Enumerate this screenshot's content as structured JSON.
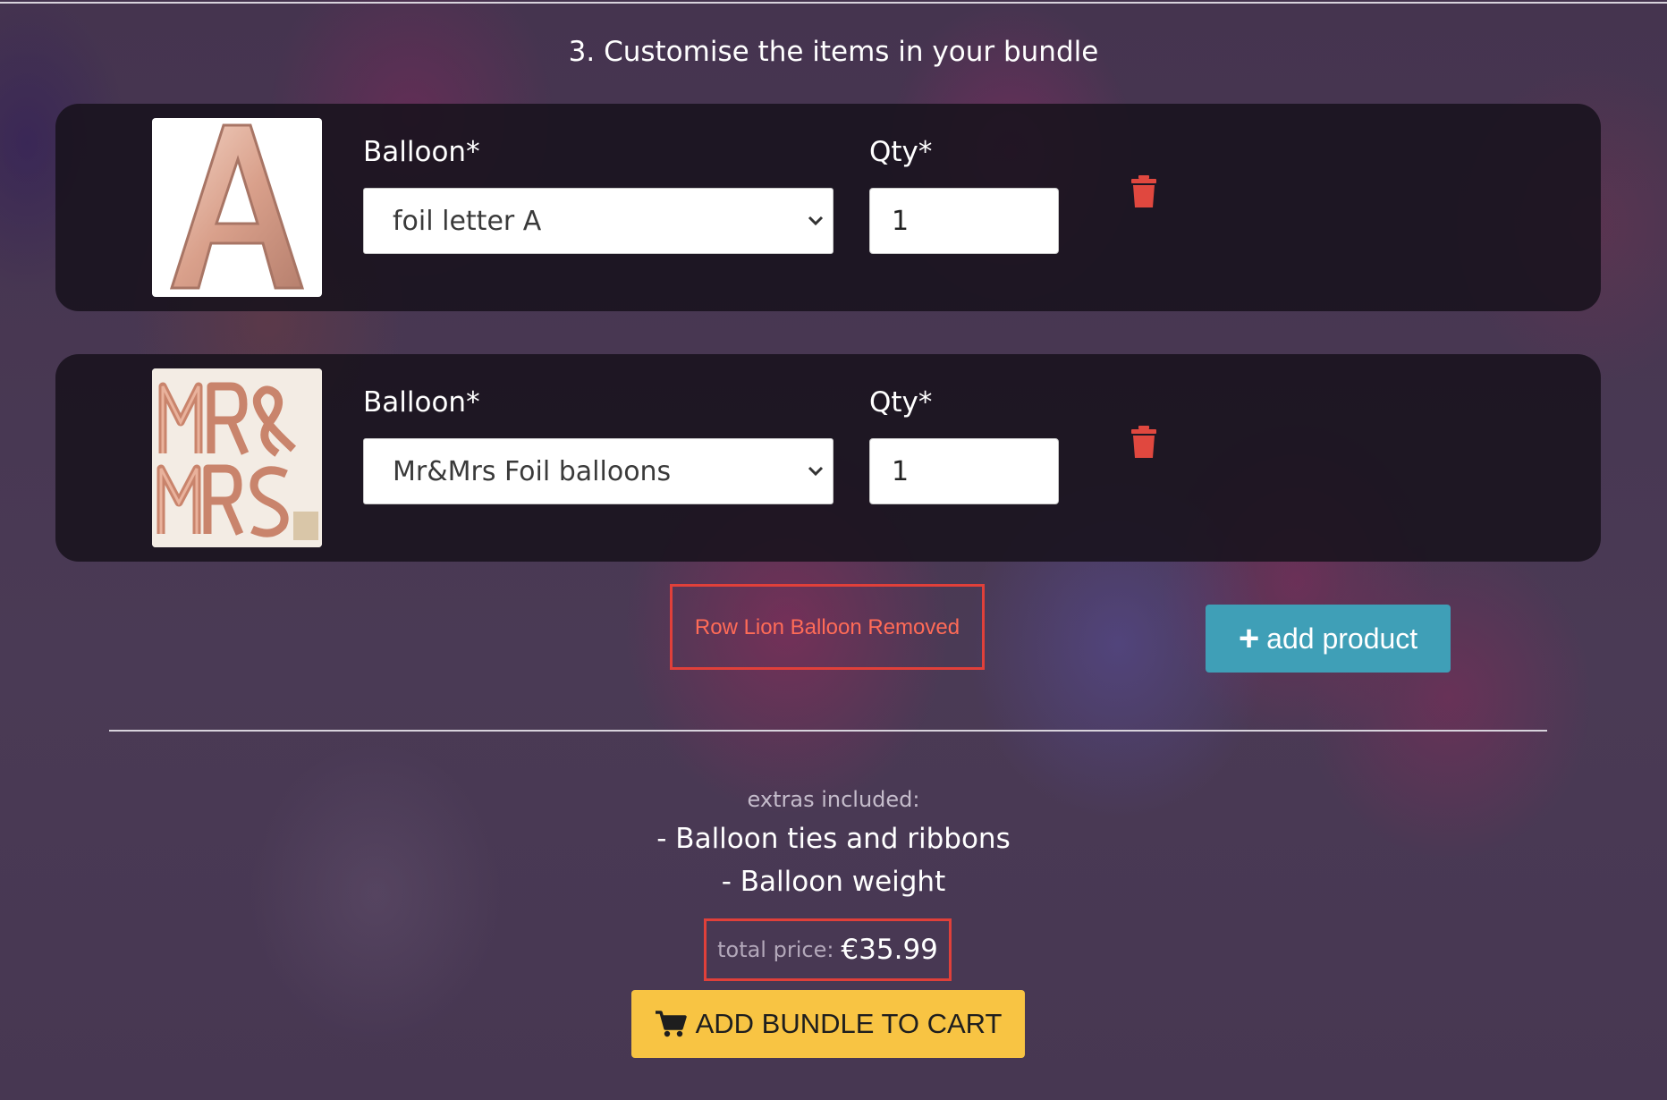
{
  "section": {
    "title": "3. Customise the items in your bundle"
  },
  "rows": [
    {
      "balloon_label": "Balloon*",
      "qty_label": "Qty*",
      "balloon_value": "foil letter A",
      "qty_value": "1",
      "thumb_icon": "foil-letter-a-image"
    },
    {
      "balloon_label": "Balloon*",
      "qty_label": "Qty*",
      "balloon_value": "Mr&Mrs Foil balloons",
      "qty_value": "1",
      "thumb_icon": "mr-mrs-foil-image"
    }
  ],
  "notice": {
    "text": "Row Lion Balloon Removed"
  },
  "add_product": {
    "label": "add product",
    "icon": "plus-icon"
  },
  "extras": {
    "label": "extras included:",
    "items": [
      "- Balloon ties and ribbons",
      "- Balloon weight"
    ]
  },
  "total": {
    "label": "total price:",
    "value": "€35.99"
  },
  "cart": {
    "label": "ADD BUNDLE TO CART",
    "icon": "cart-icon"
  },
  "colors": {
    "accent_teal": "#3f9fb7",
    "accent_yellow": "#f8c443",
    "alert_red": "#e0403a",
    "trash_red": "#e0483f"
  }
}
